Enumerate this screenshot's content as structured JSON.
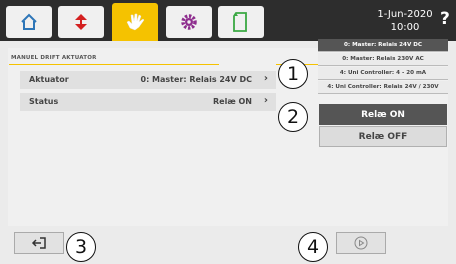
{
  "header": {
    "date": "1-Jun-2020",
    "time": "10:00",
    "help": "?",
    "tabs": [
      {
        "icon": "home-icon",
        "active": false
      },
      {
        "icon": "arrows-icon",
        "active": false
      },
      {
        "icon": "hand-icon",
        "active": true
      },
      {
        "icon": "gear-icon",
        "active": false
      },
      {
        "icon": "folder-icon",
        "active": false
      }
    ]
  },
  "panel": {
    "title": "MANUEL DRIFT AKTUATOR",
    "rows": [
      {
        "label": "Aktuator",
        "value": "0: Master: Relais 24V DC"
      },
      {
        "label": "Status",
        "value": "Relæ ON"
      }
    ]
  },
  "dropdown": {
    "options": [
      "0: Master: Relais 24V DC",
      "0: Master: Relais 230V AC",
      "4: Uni Controller: 4 - 20 mA",
      "4: Uni Controller: Relais 24V / 230V"
    ],
    "selected_index": 0
  },
  "status_options": [
    "Relæ ON",
    "Relæ OFF"
  ],
  "callouts": [
    "1",
    "2",
    "3",
    "4"
  ],
  "colors": {
    "accent": "#f5c200",
    "topbar": "#2d2d2d",
    "selected": "#555555"
  }
}
